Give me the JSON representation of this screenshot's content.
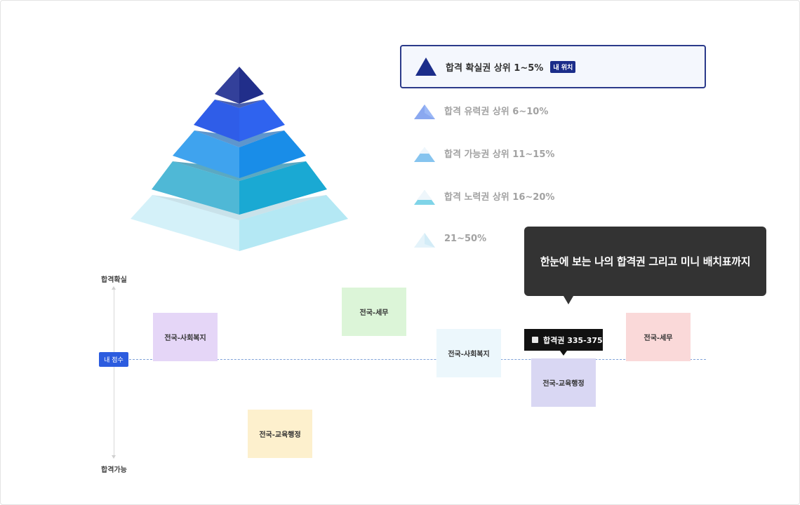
{
  "legend": [
    {
      "label": "합격 확실권 상위 1~5%",
      "badge": "내 위치",
      "color": "#1b2d8a",
      "active": true
    },
    {
      "label": "합격 유력권 상위 6~10%",
      "color": "#8aa8f0",
      "active": false
    },
    {
      "label": "합격 가능권 상위 11~15%",
      "color": "#86c4ef",
      "active": false
    },
    {
      "label": "합격 노력권 상위 16~20%",
      "color": "#7fd4e8",
      "active": false
    },
    {
      "label": "21~50%",
      "color": "#e8f6fb",
      "active": false
    }
  ],
  "tooltip": {
    "text": "한눈에 보는 나의 합격권 그리고 미니 배치표까지"
  },
  "axis": {
    "top_label": "합격확실",
    "bottom_label": "합격가능",
    "my_score_label": "내 점수"
  },
  "cards": [
    {
      "label": "전국-사회복지",
      "color": "#e5d6f7"
    },
    {
      "label": "전국-세무",
      "color": "#dcf5d8"
    },
    {
      "label": "전국-사회복지",
      "color": "#ecf7fc"
    },
    {
      "label": "전국-교육행정",
      "color": "#d9d7f3"
    },
    {
      "label": "전국-세무",
      "color": "#fad9d9"
    },
    {
      "label": "전국-교육행정",
      "color": "#fdf0cd"
    }
  ],
  "score_tip": {
    "text": "합격권 335-375"
  }
}
